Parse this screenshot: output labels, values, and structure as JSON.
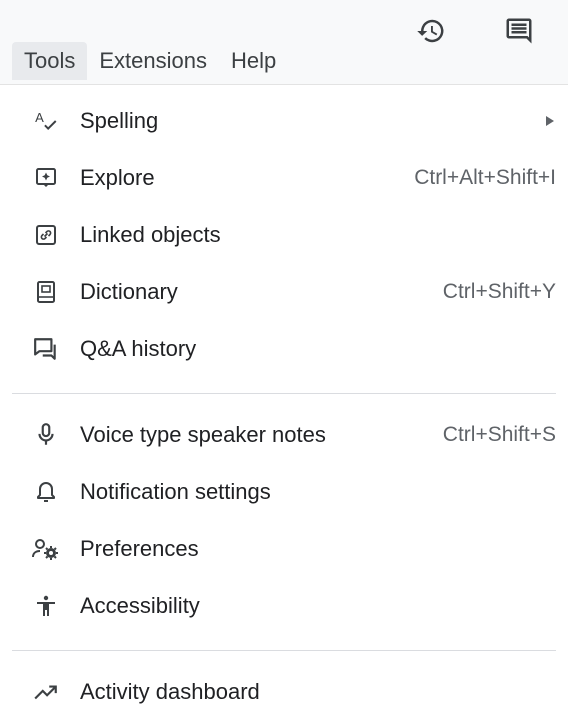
{
  "menubar": {
    "items": [
      "Tools",
      "Extensions",
      "Help"
    ],
    "active": "Tools"
  },
  "toolbar": {
    "history_icon": "history-icon",
    "comments_icon": "comments-icon"
  },
  "menu": {
    "groups": [
      {
        "items": [
          {
            "label": "Spelling",
            "icon": "spelling-icon",
            "submenu": true
          },
          {
            "label": "Explore",
            "icon": "explore-icon",
            "shortcut": "Ctrl+Alt+Shift+I"
          },
          {
            "label": "Linked objects",
            "icon": "linked-objects-icon"
          },
          {
            "label": "Dictionary",
            "icon": "dictionary-icon",
            "shortcut": "Ctrl+Shift+Y"
          },
          {
            "label": "Q&A history",
            "icon": "qa-history-icon"
          }
        ]
      },
      {
        "items": [
          {
            "label": "Voice type speaker notes",
            "icon": "microphone-icon",
            "shortcut": "Ctrl+Shift+S"
          },
          {
            "label": "Notification settings",
            "icon": "bell-icon"
          },
          {
            "label": "Preferences",
            "icon": "preferences-icon"
          },
          {
            "label": "Accessibility",
            "icon": "accessibility-icon"
          }
        ]
      },
      {
        "items": [
          {
            "label": "Activity dashboard",
            "icon": "trending-up-icon"
          }
        ]
      }
    ]
  },
  "colors": {
    "text": "#202124",
    "secondary": "#5f6368",
    "active_bg": "#e8eaed",
    "divider": "#dadce0"
  }
}
